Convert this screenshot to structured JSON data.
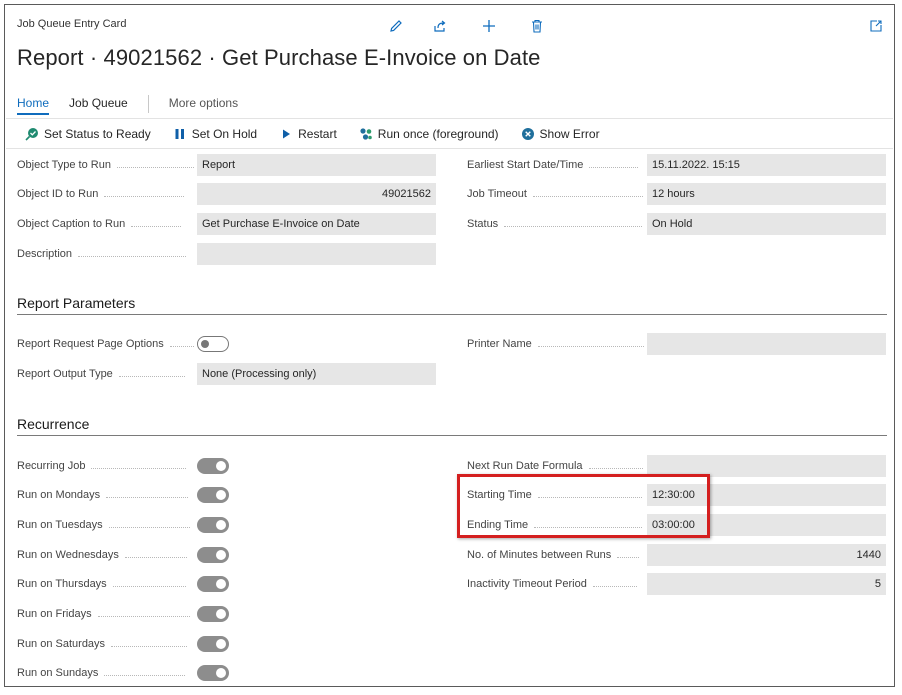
{
  "header": {
    "card_caption": "Job Queue Entry Card",
    "title": "Report · 49021562 · Get Purchase E-Invoice on Date",
    "icons": [
      "edit-icon",
      "share-icon",
      "add-icon",
      "delete-icon",
      "collapse-icon"
    ]
  },
  "tabs": [
    {
      "label": "Home",
      "active": true
    },
    {
      "label": "Job Queue",
      "active": false
    },
    {
      "label": "More options",
      "active": false
    }
  ],
  "actions": [
    {
      "label": "Set Status to Ready",
      "icon": "ready-icon"
    },
    {
      "label": "Set On Hold",
      "icon": "pause-icon"
    },
    {
      "label": "Restart",
      "icon": "play-icon"
    },
    {
      "label": "Run once (foreground)",
      "icon": "run-icon"
    },
    {
      "label": "Show Error",
      "icon": "error-icon"
    }
  ],
  "general": {
    "object_type": {
      "label": "Object Type to Run",
      "value": "Report"
    },
    "object_id": {
      "label": "Object ID to Run",
      "value": "49021562"
    },
    "object_caption": {
      "label": "Object Caption to Run",
      "value": "Get Purchase E-Invoice on Date"
    },
    "description": {
      "label": "Description",
      "value": ""
    },
    "earliest_start": {
      "label": "Earliest Start Date/Time",
      "value": "15.11.2022. 15:15"
    },
    "job_timeout": {
      "label": "Job Timeout",
      "value": "12 hours"
    },
    "status": {
      "label": "Status",
      "value": "On Hold"
    }
  },
  "report_parameters": {
    "title": "Report Parameters",
    "request_page_options": {
      "label": "Report Request Page Options",
      "on": false
    },
    "output_type": {
      "label": "Report Output Type",
      "value": "None (Processing only)"
    },
    "printer_name": {
      "label": "Printer Name",
      "value": ""
    }
  },
  "recurrence": {
    "title": "Recurrence",
    "toggles": [
      {
        "label": "Recurring Job",
        "on": true
      },
      {
        "label": "Run on Mondays",
        "on": true
      },
      {
        "label": "Run on Tuesdays",
        "on": true
      },
      {
        "label": "Run on Wednesdays",
        "on": true
      },
      {
        "label": "Run on Thursdays",
        "on": true
      },
      {
        "label": "Run on Fridays",
        "on": true
      },
      {
        "label": "Run on Saturdays",
        "on": true
      },
      {
        "label": "Run on Sundays",
        "on": true
      }
    ],
    "next_run_formula": {
      "label": "Next Run Date Formula",
      "value": ""
    },
    "starting_time": {
      "label": "Starting Time",
      "value": "12:30:00"
    },
    "ending_time": {
      "label": "Ending Time",
      "value": "03:00:00"
    },
    "minutes_between_runs": {
      "label": "No. of Minutes between Runs",
      "value": "1440"
    },
    "inactivity_timeout": {
      "label": "Inactivity Timeout Period",
      "value": "5"
    }
  },
  "colors": {
    "accent": "#0f6cbd",
    "highlight": "#d41f1f",
    "field_bg": "#e6e6e6",
    "toggle_on": "#8d8d8d"
  }
}
